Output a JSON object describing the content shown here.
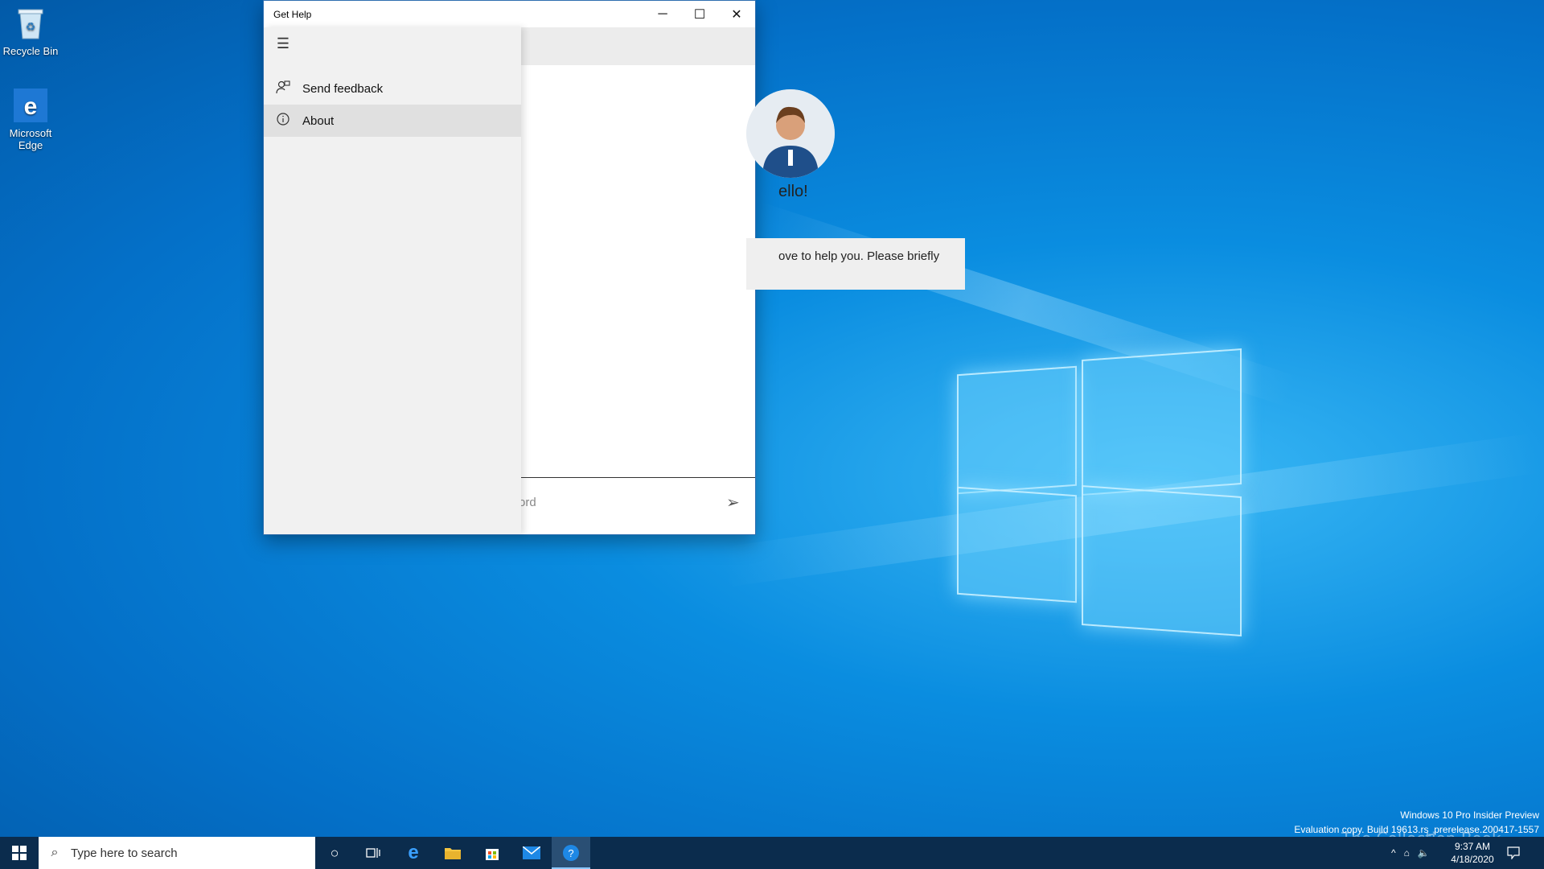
{
  "desktop": {
    "icons": [
      {
        "label": "Recycle Bin"
      },
      {
        "label": "Microsoft Edge"
      }
    ],
    "watermark": {
      "line1": "Windows 10 Pro Insider Preview",
      "line2": "Evaluation copy. Build 19613.rs_prerelease.200417-1557"
    },
    "overlay_text": "The Collection Book"
  },
  "window": {
    "title": "Get Help",
    "controls": {
      "minimize": "─",
      "maximize": "☐",
      "close": "✕"
    },
    "nav": {
      "menu_icon": "☰",
      "items": [
        {
          "label": "Send feedback",
          "icon": "feedback-icon",
          "selected": false
        },
        {
          "label": "About",
          "icon": "info-icon",
          "selected": true
        }
      ]
    },
    "chat": {
      "greeting": "ello!",
      "bubble_text": "ove to help you. Please briefly",
      "input_placeholder": "ord"
    }
  },
  "taskbar": {
    "search_placeholder": "Type here to search",
    "apps": [
      "cortana-icon",
      "task-view-icon",
      "edge-icon",
      "file-explorer-icon",
      "store-icon",
      "mail-icon",
      "get-help-icon"
    ],
    "active_app": "get-help-icon",
    "clock": {
      "time": "9:37 AM",
      "date": "4/18/2020"
    }
  }
}
